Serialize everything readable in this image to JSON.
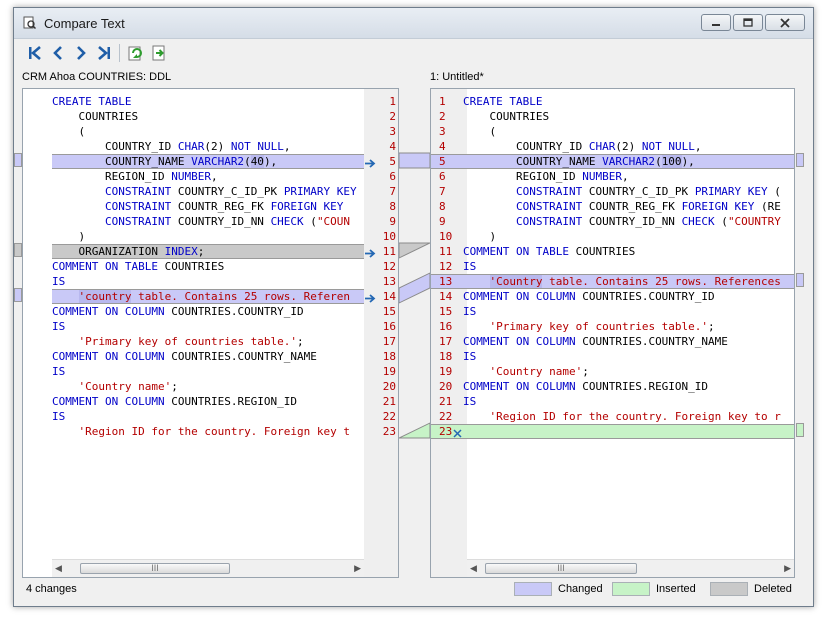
{
  "window": {
    "title": "Compare Text"
  },
  "colors": {
    "changed": "#c9c9f7",
    "inserted": "#c7f3c7",
    "deleted": "#c9c9c9"
  },
  "toolbar": {
    "icons": [
      "first-diff-icon",
      "prev-diff-icon",
      "next-diff-icon",
      "last-diff-icon",
      "refresh-icon",
      "copy-right-icon"
    ]
  },
  "left": {
    "label": "CRM Ahoa COUNTRIES: DDL",
    "lines": [
      {
        "n": "1",
        "t": [
          [
            "k",
            "CREATE TABLE"
          ]
        ]
      },
      {
        "n": "2",
        "t": [
          [
            "p",
            "    COUNTRIES"
          ]
        ]
      },
      {
        "n": "3",
        "t": [
          [
            "p",
            "    ("
          ]
        ]
      },
      {
        "n": "4",
        "t": [
          [
            "p",
            "        COUNTRY_ID "
          ],
          [
            "k",
            "CHAR"
          ],
          [
            "p",
            "(2) "
          ],
          [
            "k",
            "NOT NULL"
          ],
          [
            "p",
            ","
          ]
        ]
      },
      {
        "n": "5",
        "hl": "changed",
        "t": [
          [
            "p",
            "        COUNTRY_NAME "
          ],
          [
            "k",
            "VARCHAR2"
          ],
          [
            "p",
            "("
          ],
          [
            "h",
            "40"
          ],
          [
            "p",
            "),"
          ]
        ]
      },
      {
        "n": "6",
        "t": [
          [
            "p",
            "        REGION_ID "
          ],
          [
            "k",
            "NUMBER"
          ],
          [
            "p",
            ","
          ]
        ]
      },
      {
        "n": "7",
        "t": [
          [
            "p",
            "        "
          ],
          [
            "k",
            "CONSTRAINT"
          ],
          [
            "p",
            " COUNTRY_C_ID_PK "
          ],
          [
            "k",
            "PRIMARY KEY"
          ]
        ]
      },
      {
        "n": "8",
        "t": [
          [
            "p",
            "        "
          ],
          [
            "k",
            "CONSTRAINT"
          ],
          [
            "p",
            " COUNTR_REG_FK "
          ],
          [
            "k",
            "FOREIGN KEY"
          ]
        ]
      },
      {
        "n": "9",
        "t": [
          [
            "p",
            "        "
          ],
          [
            "k",
            "CONSTRAINT"
          ],
          [
            "p",
            " COUNTRY_ID_NN "
          ],
          [
            "k",
            "CHECK"
          ],
          [
            "p",
            " ("
          ],
          [
            "s",
            "\"COUN"
          ]
        ]
      },
      {
        "n": "10",
        "t": [
          [
            "p",
            "    )"
          ]
        ]
      },
      {
        "n": "11",
        "hl": "deleted",
        "t": [
          [
            "p",
            "    ORGANIZATION "
          ],
          [
            "k",
            "INDEX"
          ],
          [
            "p",
            ";"
          ]
        ]
      },
      {
        "n": "12",
        "t": [
          [
            "k",
            "COMMENT ON TABLE"
          ],
          [
            "p",
            " COUNTRIES"
          ]
        ]
      },
      {
        "n": "13",
        "t": [
          [
            "k",
            "IS"
          ]
        ]
      },
      {
        "n": "14",
        "hl": "changed",
        "t": [
          [
            "p",
            "    "
          ],
          [
            "sh",
            "'country"
          ],
          [
            "s",
            " table. Contains 25 rows. Referen"
          ]
        ]
      },
      {
        "n": "15",
        "t": [
          [
            "k",
            "COMMENT ON COLUMN"
          ],
          [
            "p",
            " COUNTRIES.COUNTRY_ID"
          ]
        ]
      },
      {
        "n": "16",
        "t": [
          [
            "k",
            "IS"
          ]
        ]
      },
      {
        "n": "17",
        "t": [
          [
            "p",
            "    "
          ],
          [
            "s",
            "'Primary key of countries table.'"
          ],
          [
            "p",
            ";"
          ]
        ]
      },
      {
        "n": "18",
        "t": [
          [
            "k",
            "COMMENT ON COLUMN"
          ],
          [
            "p",
            " COUNTRIES.COUNTRY_NAME"
          ]
        ]
      },
      {
        "n": "19",
        "t": [
          [
            "k",
            "IS"
          ]
        ]
      },
      {
        "n": "20",
        "t": [
          [
            "p",
            "    "
          ],
          [
            "s",
            "'Country name'"
          ],
          [
            "p",
            ";"
          ]
        ]
      },
      {
        "n": "21",
        "t": [
          [
            "k",
            "COMMENT ON COLUMN"
          ],
          [
            "p",
            " COUNTRIES.REGION_ID"
          ]
        ]
      },
      {
        "n": "22",
        "t": [
          [
            "k",
            "IS"
          ]
        ]
      },
      {
        "n": "23",
        "t": [
          [
            "p",
            "    "
          ],
          [
            "s",
            "'Region ID for the country. Foreign key t"
          ]
        ]
      }
    ]
  },
  "right": {
    "label": "1: Untitled*",
    "lines": [
      {
        "n": "1",
        "t": [
          [
            "k",
            "CREATE TABLE"
          ]
        ]
      },
      {
        "n": "2",
        "t": [
          [
            "p",
            "    COUNTRIES"
          ]
        ]
      },
      {
        "n": "3",
        "t": [
          [
            "p",
            "    ("
          ]
        ]
      },
      {
        "n": "4",
        "t": [
          [
            "p",
            "        COUNTRY_ID "
          ],
          [
            "k",
            "CHAR"
          ],
          [
            "p",
            "(2) "
          ],
          [
            "k",
            "NOT NULL"
          ],
          [
            "p",
            ","
          ]
        ]
      },
      {
        "n": "5",
        "hl": "changed",
        "t": [
          [
            "p",
            "        COUNTRY_NAME "
          ],
          [
            "k",
            "VARCHAR2"
          ],
          [
            "p",
            "("
          ],
          [
            "h",
            "100"
          ],
          [
            "p",
            "),"
          ]
        ]
      },
      {
        "n": "6",
        "t": [
          [
            "p",
            "        REGION_ID "
          ],
          [
            "k",
            "NUMBER"
          ],
          [
            "p",
            ","
          ]
        ]
      },
      {
        "n": "7",
        "t": [
          [
            "p",
            "        "
          ],
          [
            "k",
            "CONSTRAINT"
          ],
          [
            "p",
            " COUNTRY_C_ID_PK "
          ],
          [
            "k",
            "PRIMARY KEY"
          ],
          [
            "p",
            " ("
          ]
        ]
      },
      {
        "n": "8",
        "t": [
          [
            "p",
            "        "
          ],
          [
            "k",
            "CONSTRAINT"
          ],
          [
            "p",
            " COUNTR_REG_FK "
          ],
          [
            "k",
            "FOREIGN KEY"
          ],
          [
            "p",
            " (RE"
          ]
        ]
      },
      {
        "n": "9",
        "t": [
          [
            "p",
            "        "
          ],
          [
            "k",
            "CONSTRAINT"
          ],
          [
            "p",
            " COUNTRY_ID_NN "
          ],
          [
            "k",
            "CHECK"
          ],
          [
            "p",
            " ("
          ],
          [
            "s",
            "\"COUNTRY"
          ]
        ]
      },
      {
        "n": "10",
        "t": [
          [
            "p",
            "    )"
          ]
        ]
      },
      {
        "n": "11",
        "t": [
          [
            "k",
            "COMMENT ON TABLE"
          ],
          [
            "p",
            " COUNTRIES"
          ]
        ]
      },
      {
        "n": "12",
        "t": [
          [
            "k",
            "IS"
          ]
        ]
      },
      {
        "n": "13",
        "hl": "changed",
        "t": [
          [
            "p",
            "    "
          ],
          [
            "sh",
            "'Country"
          ],
          [
            "s",
            " table. Contains 25 rows. References"
          ]
        ]
      },
      {
        "n": "14",
        "t": [
          [
            "k",
            "COMMENT ON COLUMN"
          ],
          [
            "p",
            " COUNTRIES.COUNTRY_ID"
          ]
        ]
      },
      {
        "n": "15",
        "t": [
          [
            "k",
            "IS"
          ]
        ]
      },
      {
        "n": "16",
        "t": [
          [
            "p",
            "    "
          ],
          [
            "s",
            "'Primary key of countries table.'"
          ],
          [
            "p",
            ";"
          ]
        ]
      },
      {
        "n": "17",
        "t": [
          [
            "k",
            "COMMENT ON COLUMN"
          ],
          [
            "p",
            " COUNTRIES.COUNTRY_NAME"
          ]
        ]
      },
      {
        "n": "18",
        "t": [
          [
            "k",
            "IS"
          ]
        ]
      },
      {
        "n": "19",
        "t": [
          [
            "p",
            "    "
          ],
          [
            "s",
            "'Country name'"
          ],
          [
            "p",
            ";"
          ]
        ]
      },
      {
        "n": "20",
        "t": [
          [
            "k",
            "COMMENT ON COLUMN"
          ],
          [
            "p",
            " COUNTRIES.REGION_ID"
          ]
        ]
      },
      {
        "n": "21",
        "t": [
          [
            "k",
            "IS"
          ]
        ]
      },
      {
        "n": "22",
        "t": [
          [
            "p",
            "    "
          ],
          [
            "s",
            "'Region ID for the country. Foreign key to r"
          ]
        ]
      },
      {
        "n": "23",
        "hl": "inserted",
        "t": []
      }
    ]
  },
  "status": {
    "changes": "4 changes"
  },
  "legend": [
    {
      "label": "Changed",
      "color": "#c9c9f7"
    },
    {
      "label": "Inserted",
      "color": "#c7f3c7"
    },
    {
      "label": "Deleted",
      "color": "#c9c9c9"
    }
  ],
  "scroll": {
    "grip": "III"
  }
}
